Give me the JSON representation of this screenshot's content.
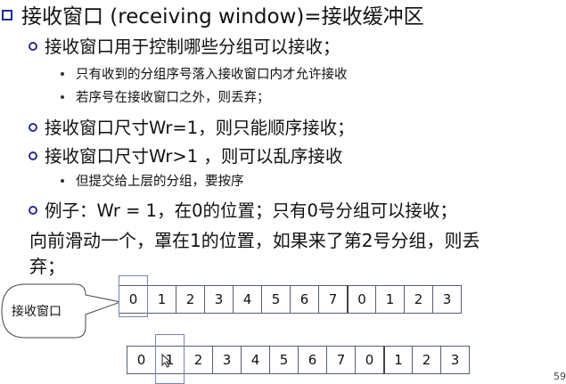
{
  "title": "接收窗口 (receiving window)=接收缓冲区",
  "points": [
    {
      "text": "接收窗口用于控制哪些分组可以接收；"
    },
    {
      "text": "只有收到的分组序号落入接收窗口内才允许接收"
    },
    {
      "text": "若序号在接收窗口之外，则丢弃；"
    },
    {
      "text": "接收窗口尺寸Wr=1，则只能顺序接收；"
    },
    {
      "text": "接收窗口尺寸Wr>1 ，则可以乱序接收"
    },
    {
      "text": "但提交给上层的分组，要按序"
    },
    {
      "text": "例子：Wr = 1，在0的位置；只有0号分组可以接收；"
    }
  ],
  "paragraph": {
    "line1": "向前滑动一个，罩在1的位置，如果来了第2号分组，则丢",
    "line2": "弃；"
  },
  "callout_label": "接收窗口",
  "seq_top": [
    "0",
    "1",
    "2",
    "3",
    "4",
    "5",
    "6",
    "7",
    "0",
    "1",
    "2",
    "3"
  ],
  "seq_bottom": [
    "0",
    "1",
    "2",
    "3",
    "4",
    "5",
    "6",
    "7",
    "0",
    "1",
    "2",
    "3"
  ],
  "page_number": "59",
  "colors": {
    "bullet": "#1f2d8a",
    "window_frame": "#7a82b8"
  }
}
